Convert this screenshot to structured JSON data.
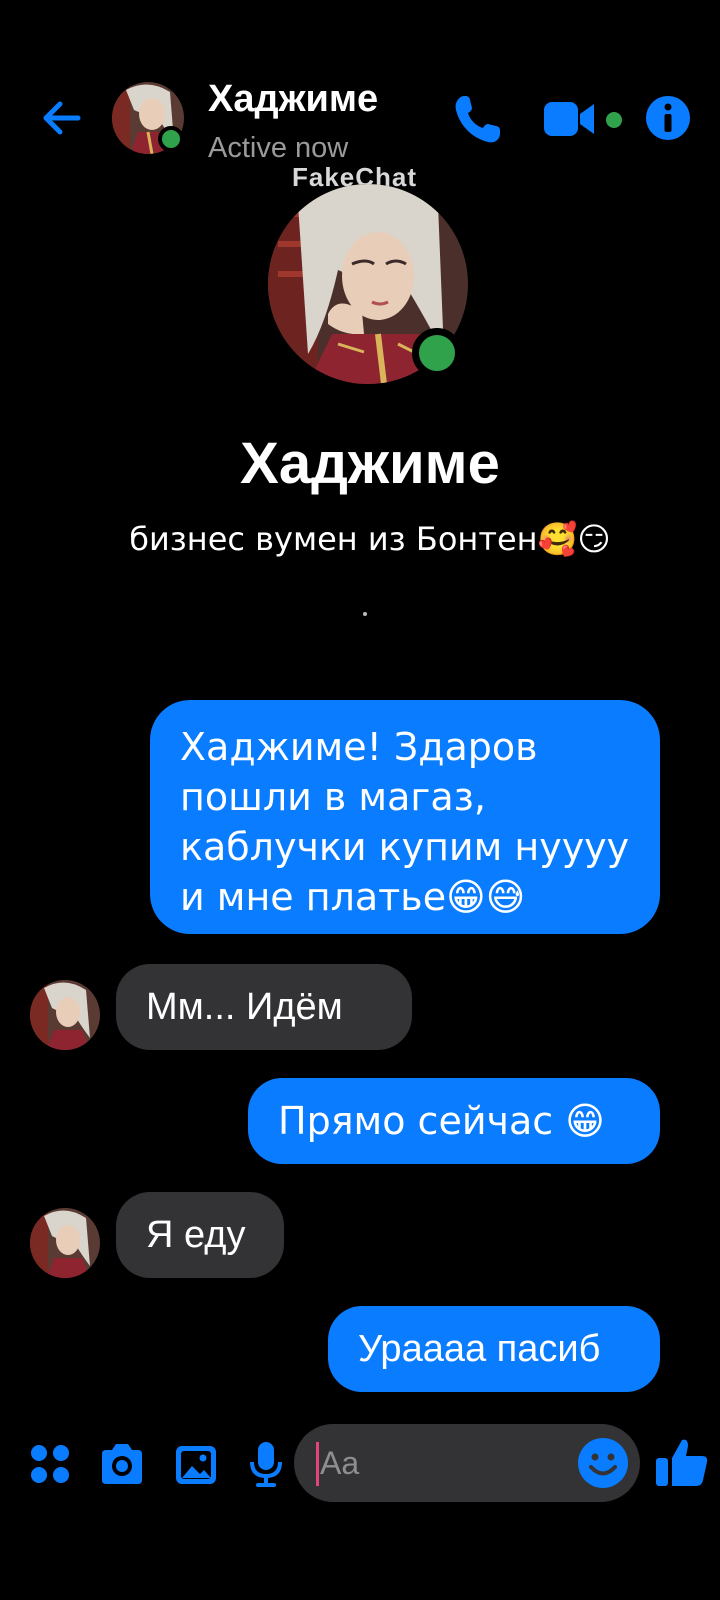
{
  "header": {
    "back_icon": "arrow-left-icon",
    "contact_name": "Хаджиме",
    "status": "Active now",
    "call_icon": "phone-icon",
    "video_icon": "video-camera-icon",
    "info_icon": "info-icon"
  },
  "watermark": "FakeChat",
  "profile": {
    "name": "Хаджиме",
    "bio": "бизнес вумен из Бонтен🥰😏"
  },
  "messages": [
    {
      "direction": "out",
      "text": "Хаджиме! Здаров пошли в магаз, каблучки купим нуууу и мне платье😁😅"
    },
    {
      "direction": "in",
      "text": "Мм... Идём"
    },
    {
      "direction": "out",
      "text": "Прямо сейчас 😁"
    },
    {
      "direction": "in",
      "text": "Я еду"
    },
    {
      "direction": "out",
      "text": "Ураааа пасиб"
    }
  ],
  "composer": {
    "placeholder": "Aa",
    "icons": [
      "apps-icon",
      "camera-icon",
      "gallery-icon",
      "microphone-icon",
      "emoji-icon",
      "thumbs-up-icon"
    ]
  },
  "colors": {
    "accent": "#0a7cff",
    "online": "#31a24c",
    "incoming_bubble": "#333336",
    "background": "#000000"
  }
}
